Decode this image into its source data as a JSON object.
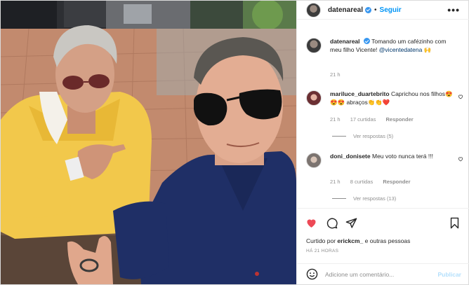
{
  "post": {
    "username": "datenareal",
    "separator": "•",
    "follow_label": "Seguir",
    "more_label": "•••"
  },
  "caption": {
    "username": "datenareal",
    "text": "Tomando um cafézinho com meu filho Vicente!",
    "mention": "@vicentedatena",
    "emoji": "🙌",
    "time": "21 h"
  },
  "comments": [
    {
      "username": "mariluce_duartebrito",
      "text": "Caprichou nos filhos😍😍😍 abraços👏👏❤️",
      "time": "21 h",
      "likes": "17 curtidas",
      "reply": "Responder",
      "view_replies": "Ver respostas (5)"
    },
    {
      "username": "doni_donisete",
      "text": "Meu voto nunca terá !!!",
      "time": "21 h",
      "likes": "8 curtidas",
      "reply": "Responder",
      "view_replies": "Ver respostas (13)"
    }
  ],
  "likes": {
    "prefix": "Curtido por ",
    "user": "erickcm_",
    "suffix": " e outras pessoas"
  },
  "timestamp": "HÁ 21 HORAS",
  "comment_box": {
    "placeholder": "Adicione um comentário...",
    "publish_label": "Publicar"
  },
  "colors": {
    "accent": "#0095f6",
    "like_red": "#ed4956",
    "publish_disabled": "#b2dffc"
  },
  "icons": [
    "heart-icon",
    "comment-icon",
    "share-icon",
    "bookmark-icon",
    "emoji-icon",
    "more-icon",
    "verified-icon"
  ]
}
